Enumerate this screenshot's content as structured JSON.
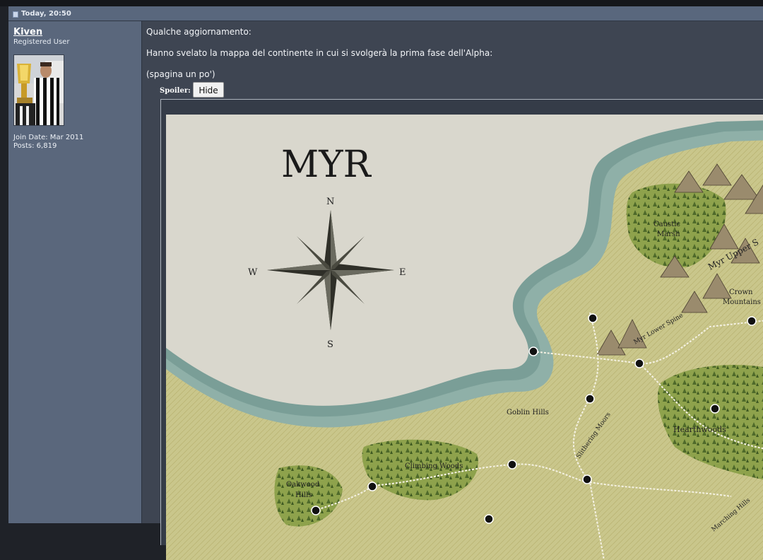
{
  "header": {
    "date": "Today, 20:50"
  },
  "user": {
    "name": "Kiven",
    "title": "Registered User",
    "join_date": "Join Date: Mar 2011",
    "posts": "Posts: 6,819"
  },
  "post": {
    "line1": "Qualche aggiornamento:",
    "line2": "Hanno svelato la mappa del continente in cui si svolgerà la prima fase dell'Alpha:",
    "line3": "(spagina un po')",
    "spoiler_label": "Spoiler:",
    "hide_button": "Hide"
  },
  "map": {
    "title": "MYR",
    "compass": {
      "n": "N",
      "s": "S",
      "e": "E",
      "w": "W"
    },
    "labels": {
      "caustic1": "Caustic",
      "caustic2": "Marsh",
      "upper": "Myr Upper S",
      "crown1": "Crown",
      "crown2": "Mountains",
      "lower": "Myr Lower Spine",
      "goblin": "Goblin Hills",
      "slithering": "Slithering Moors",
      "hearth": "Hearthwoods",
      "climbing": "Climbing Woods",
      "oak1": "Oakwood",
      "oak2": "Hills",
      "marching": "Marching Hills"
    },
    "colors": {
      "sea": "#7a9e97",
      "land": "#c7c58a",
      "paper": "#d9d7cd",
      "forest": "#6d8a3a"
    }
  }
}
